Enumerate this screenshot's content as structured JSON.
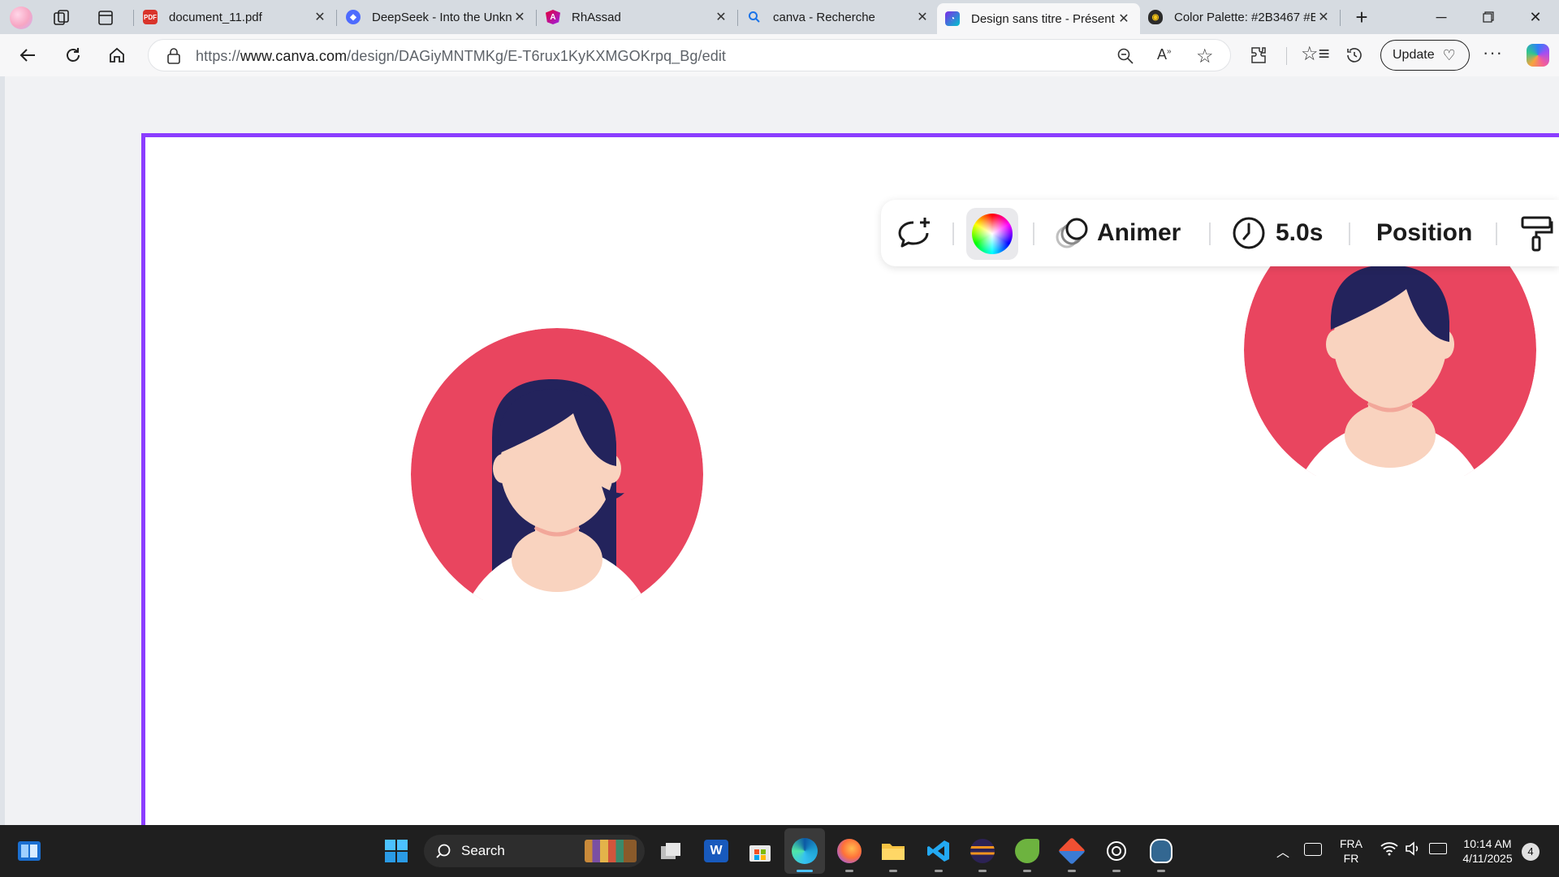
{
  "browser": {
    "tabs": [
      {
        "title": "document_11.pdf",
        "icon": "pdf-icon"
      },
      {
        "title": "DeepSeek - Into the Unkn",
        "icon": "deepseek-icon"
      },
      {
        "title": "RhAssad",
        "icon": "angular-icon"
      },
      {
        "title": "canva - Recherche",
        "icon": "search-icon"
      },
      {
        "title": "Design sans titre - Présent",
        "icon": "canva-icon",
        "active": true
      },
      {
        "title": "Color Palette: #2B3467 #B",
        "icon": "palette-icon"
      }
    ],
    "url_prefix": "https://",
    "url_host": "www.canva.com",
    "url_path": "/design/DAGiyMNTMKg/E-T6rux1KyKXMGOKrpq_Bg/edit",
    "update_label": "Update"
  },
  "toolbar": {
    "animate_label": "Animer",
    "duration_label": "5.0s",
    "position_label": "Position"
  },
  "colors": {
    "accent_purple": "#8b3dff",
    "avatar_bg": "#e9455f",
    "hair": "#23235c",
    "skin": "#f9d3bf"
  },
  "taskbar": {
    "search_label": "Search",
    "lang_top": "FRA",
    "lang_bottom": "FR",
    "time": "10:14 AM",
    "date": "4/11/2025",
    "notif_count": "4"
  }
}
